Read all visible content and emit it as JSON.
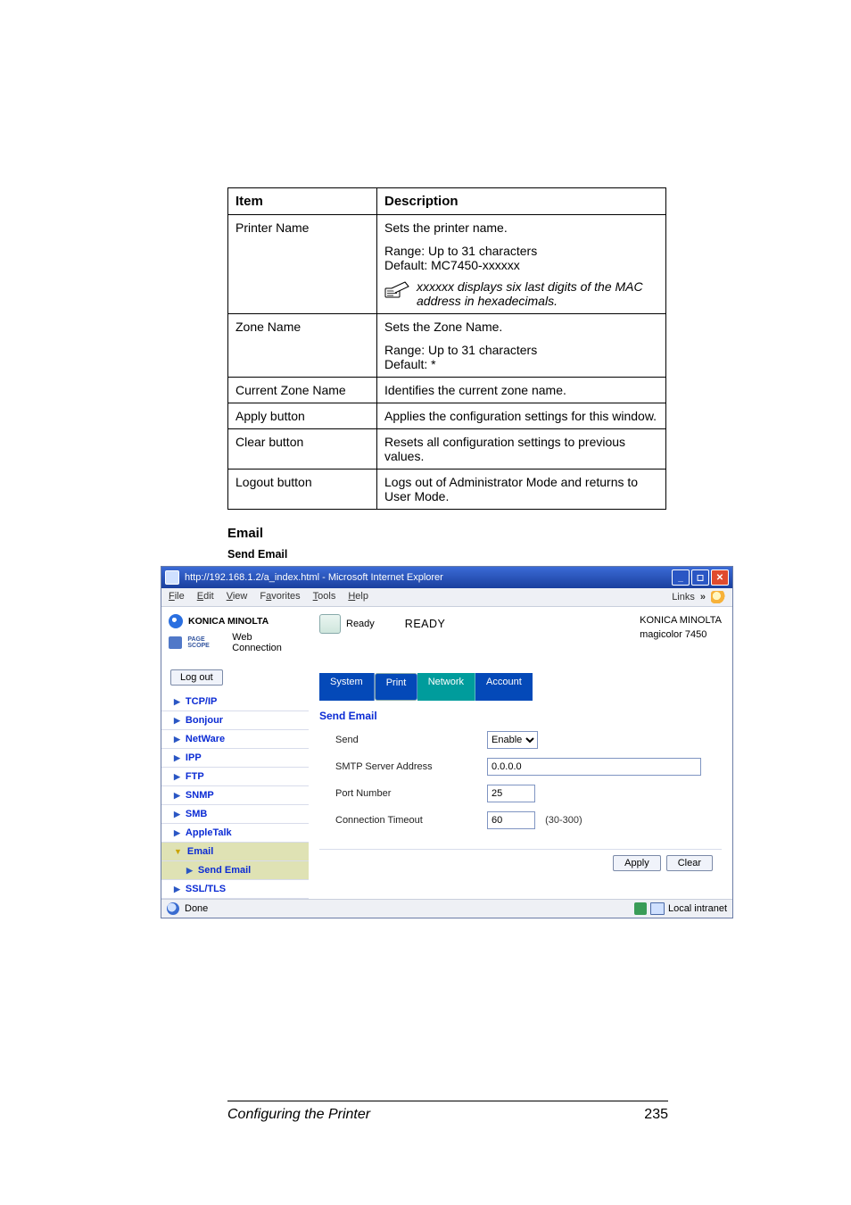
{
  "table": {
    "headers": [
      "Item",
      "Description"
    ],
    "rows": [
      {
        "item": "Printer Name",
        "desc_main": "Sets the printer name.",
        "range": "Range:   Up to 31 characters",
        "default": "Default:  MC7450-xxxxxx",
        "note": "xxxxxx displays six last digits of the MAC address in hexadecimals."
      },
      {
        "item": "Zone Name",
        "desc_main": "Sets the Zone Name.",
        "range": "Range:   Up to 31 characters",
        "default": "Default:  *"
      },
      {
        "item": "Current Zone Name",
        "desc_main": "Identifies the current zone name."
      },
      {
        "item": "Apply button",
        "desc_main": "Applies the configuration settings for this window."
      },
      {
        "item": "Clear button",
        "desc_main": "Resets all configuration settings to previous values."
      },
      {
        "item": "Logout button",
        "desc_main": "Logs out of Administrator Mode and returns to User Mode."
      }
    ]
  },
  "headings": {
    "email": "Email",
    "send": "Send Email"
  },
  "browser": {
    "title": "http://192.168.1.2/a_index.html - Microsoft Internet Explorer",
    "menus": {
      "file": "File",
      "edit": "Edit",
      "view": "View",
      "favorites": "Favorites",
      "tools": "Tools",
      "help": "Help"
    },
    "links_label": "Links",
    "brand": {
      "km": "KONICA MINOLTA",
      "psw": "Web Connection",
      "ps_badge": "PAGE SCOPE"
    },
    "status_word": "Ready",
    "status_big": "READY",
    "id": {
      "l1": "KONICA MINOLTA",
      "l2": "magicolor 7450"
    },
    "logout": "Log out",
    "tabs": {
      "system": "System",
      "print": "Print",
      "network": "Network",
      "account": "Account"
    },
    "nav": {
      "tcpip": "TCP/IP",
      "bonjour": "Bonjour",
      "netware": "NetWare",
      "ipp": "IPP",
      "ftp": "FTP",
      "snmp": "SNMP",
      "smb": "SMB",
      "appletalk": "AppleTalk",
      "email": "Email",
      "send_email": "Send Email",
      "ssl": "SSL/TLS"
    },
    "panel": {
      "title": "Send Email",
      "labels": {
        "send": "Send",
        "smtp": "SMTP Server Address",
        "port": "Port Number",
        "timeout": "Connection Timeout"
      },
      "values": {
        "send_opt": "Enable",
        "smtp": "0.0.0.0",
        "port": "25",
        "timeout": "60",
        "timeout_suffix": "(30-300)"
      }
    },
    "buttons": {
      "apply": "Apply",
      "clear": "Clear"
    },
    "statusbar": {
      "done": "Done",
      "zone": "Local intranet"
    }
  },
  "footer": {
    "title": "Configuring the Printer",
    "page": "235"
  }
}
